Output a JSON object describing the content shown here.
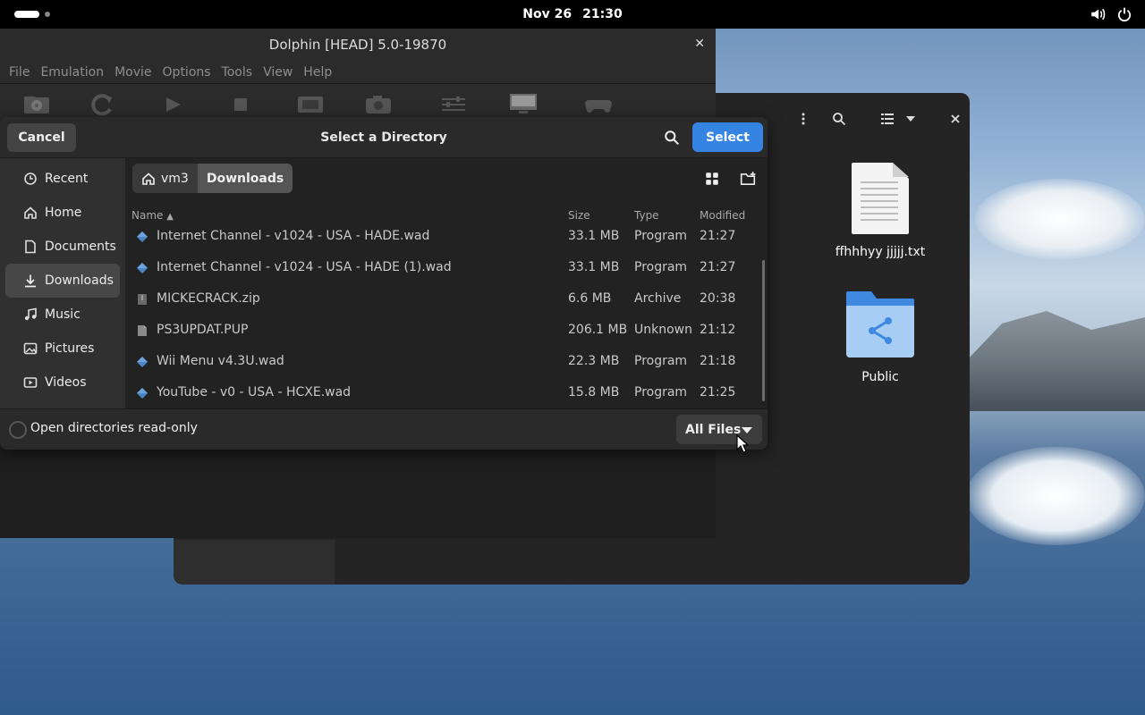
{
  "topbar": {
    "date": "Nov 26",
    "time": "21:30"
  },
  "desktop_files": [
    {
      "name": "ffhhhyy jjjjj.txt",
      "icon": "text-file-icon"
    },
    {
      "name": "Public",
      "icon": "shared-folder-icon"
    }
  ],
  "dolphin": {
    "title": "Dolphin [HEAD] 5.0-19870",
    "menu": [
      "File",
      "Emulation",
      "Movie",
      "Options",
      "Tools",
      "View",
      "Help"
    ]
  },
  "dialog": {
    "title": "Select a Directory",
    "cancel_label": "Cancel",
    "select_label": "Select",
    "places": [
      {
        "label": "Recent",
        "icon": "clock-icon"
      },
      {
        "label": "Home",
        "icon": "home-icon"
      },
      {
        "label": "Documents",
        "icon": "document-icon"
      },
      {
        "label": "Downloads",
        "icon": "download-icon",
        "active": true
      },
      {
        "label": "Music",
        "icon": "music-icon"
      },
      {
        "label": "Pictures",
        "icon": "picture-icon"
      },
      {
        "label": "Videos",
        "icon": "video-icon"
      }
    ],
    "path": [
      "vm3",
      "Downloads"
    ],
    "columns": {
      "name": "Name",
      "size": "Size",
      "type": "Type",
      "modified": "Modified"
    },
    "files": [
      {
        "name": "Internet Channel - v1024 - USA - HADE.wad",
        "size": "33.1 MB",
        "type": "Program",
        "modified": "21:27",
        "icon": "program-icon"
      },
      {
        "name": "Internet Channel - v1024 - USA - HADE (1).wad",
        "size": "33.1 MB",
        "type": "Program",
        "modified": "21:27",
        "icon": "program-icon"
      },
      {
        "name": "MICKECRACK.zip",
        "size": "6.6 MB",
        "type": "Archive",
        "modified": "20:38",
        "icon": "archive-icon"
      },
      {
        "name": "PS3UPDAT.PUP",
        "size": "206.1 MB",
        "type": "Unknown",
        "modified": "21:12",
        "icon": "file-icon"
      },
      {
        "name": "Wii Menu v4.3U.wad",
        "size": "22.3 MB",
        "type": "Program",
        "modified": "21:18",
        "icon": "program-icon"
      },
      {
        "name": "YouTube - v0 - USA - HCXE.wad",
        "size": "15.8 MB",
        "type": "Program",
        "modified": "21:25",
        "icon": "program-icon"
      }
    ],
    "readonly_label": "Open directories read-only",
    "filter_label": "All Files"
  }
}
